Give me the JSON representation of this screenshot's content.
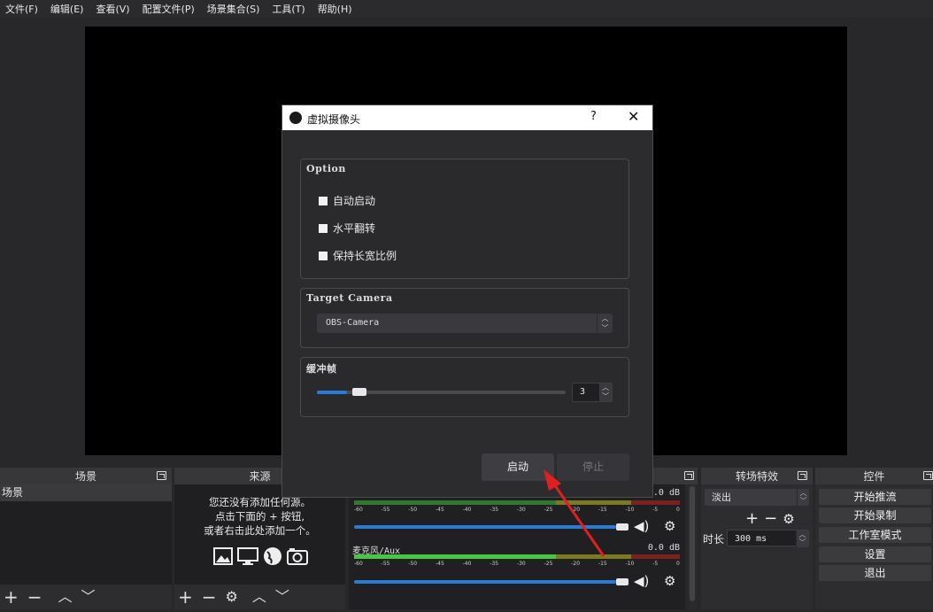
{
  "menu": [
    "文件(F)",
    "编辑(E)",
    "查看(V)",
    "配置文件(P)",
    "场景集合(S)",
    "工具(T)",
    "帮助(H)"
  ],
  "scenes": {
    "title": "场景",
    "items": [
      "场景"
    ]
  },
  "sources": {
    "title": "来源",
    "empty_hint": [
      "您还没有添加任何源。",
      "点击下面的 + 按钮,",
      "或者右击此处添加一个。"
    ]
  },
  "mixer": {
    "tracks": [
      {
        "name": "",
        "db": "0.0 dB",
        "volume": 0.98
      },
      {
        "name": "麦克风/Aux",
        "db": "0.0 dB",
        "volume": 0.98
      }
    ],
    "ticks": [
      "-60",
      "-55",
      "-50",
      "-45",
      "-40",
      "-35",
      "-30",
      "-25",
      "-20",
      "-15",
      "-10",
      "-5",
      "0"
    ]
  },
  "transitions": {
    "title": "转场特效",
    "selected": "淡出",
    "duration_label": "时长",
    "duration_value": "300 ms"
  },
  "controls": {
    "title": "控件",
    "buttons": [
      "开始推流",
      "开始录制",
      "工作室模式",
      "设置",
      "退出"
    ]
  },
  "dialog": {
    "title": "虚拟摄像头",
    "help": "?",
    "close": "✕",
    "option_group": "Option",
    "options": [
      {
        "label": "自动启动",
        "checked": false
      },
      {
        "label": "水平翻转",
        "checked": false
      },
      {
        "label": "保持长宽比例",
        "checked": false
      }
    ],
    "camera_group": "Target Camera",
    "camera_value": "OBS-Camera",
    "buffer_group": "缓冲帧",
    "buffer_value": "3",
    "buffer_fraction": 0.12,
    "start_label": "启动",
    "stop_label": "停止"
  },
  "colors": {
    "accent": "#2a7bd6",
    "annotation_arrow": "#e02020"
  }
}
